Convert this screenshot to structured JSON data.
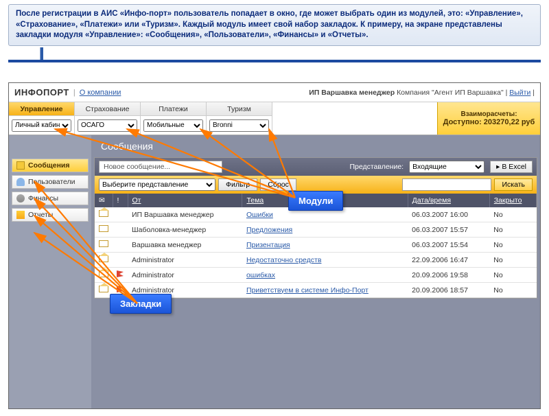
{
  "description": "После регистрации в АИС «Инфо-порт» пользователь попадает в окно, где может выбрать один из модулей, это: «Управление», «Страхование», «Платежи» или «Туризм». Каждый модуль имеет свой набор закладок. К примеру, на экране представлены закладки модуля «Управление»: «Сообщения», «Пользователи», «Финансы» и «Отчеты».",
  "header": {
    "logo": "ИНФОПОРТ",
    "about_link": "О компании",
    "user_label": "ИП Варшавка менеджер",
    "company_label": "Компания",
    "company_value": "\"Агент ИП Варшавка\"",
    "logout": "Выйти"
  },
  "modules": [
    {
      "name": "Управление",
      "select": "Личный кабинет",
      "active": true
    },
    {
      "name": "Страхование",
      "select": "ОСАГО",
      "active": false
    },
    {
      "name": "Платежи",
      "select": "Мобильные",
      "active": false
    },
    {
      "name": "Туризм",
      "select": "Bronni",
      "active": false
    }
  ],
  "balance": {
    "label": "Взаиморасчеты:",
    "text": "Доступно: 203270,22 руб"
  },
  "section_title": "Сообщения",
  "sidebar": [
    {
      "label": "Сообщения",
      "icon": "ico-msg",
      "active": true
    },
    {
      "label": "Пользователи",
      "icon": "ico-user",
      "active": false
    },
    {
      "label": "Финансы",
      "icon": "ico-fin",
      "active": false
    },
    {
      "label": "Отчеты",
      "icon": "ico-rep",
      "active": false
    }
  ],
  "toolbar1": {
    "new_msg": "Новое сообщение...",
    "view_label": "Представление:",
    "view_value": "Входящие",
    "excel": "В Excel"
  },
  "toolbar2": {
    "select": "Выберите представление",
    "filter": "Фильтр",
    "reset": "Сброс",
    "search_btn": "Искать"
  },
  "table": {
    "headers": {
      "from": "От",
      "subject": "Тема",
      "datetime": "Дата/время",
      "closed": "Закрыто"
    },
    "rows": [
      {
        "open": true,
        "flag": false,
        "from": "ИП Варшавка менеджер",
        "subject": "Ошибки",
        "dt": "06.03.2007 16:00",
        "closed": "No"
      },
      {
        "open": false,
        "flag": false,
        "from": "Шаболовка-менеджер",
        "subject": "Предложения",
        "dt": "06.03.2007 15:57",
        "closed": "No"
      },
      {
        "open": false,
        "flag": false,
        "from": "Варшавка менеджер",
        "subject": "Призентация",
        "dt": "06.03.2007 15:54",
        "closed": "No"
      },
      {
        "open": true,
        "flag": false,
        "from": "Administrator",
        "subject": "Недостаточно средств",
        "dt": "22.09.2006 16:47",
        "closed": "No"
      },
      {
        "open": true,
        "flag": true,
        "from": "Administrator",
        "subject": "ошибках",
        "dt": "20.09.2006 19:58",
        "closed": "No"
      },
      {
        "open": true,
        "flag": true,
        "from": "Administrator",
        "subject": "Приветствуем в системе Инфо-Порт",
        "dt": "20.09.2006 18:57",
        "closed": "No"
      }
    ]
  },
  "callouts": {
    "modules": "Модули",
    "tabs": "Закладки"
  }
}
